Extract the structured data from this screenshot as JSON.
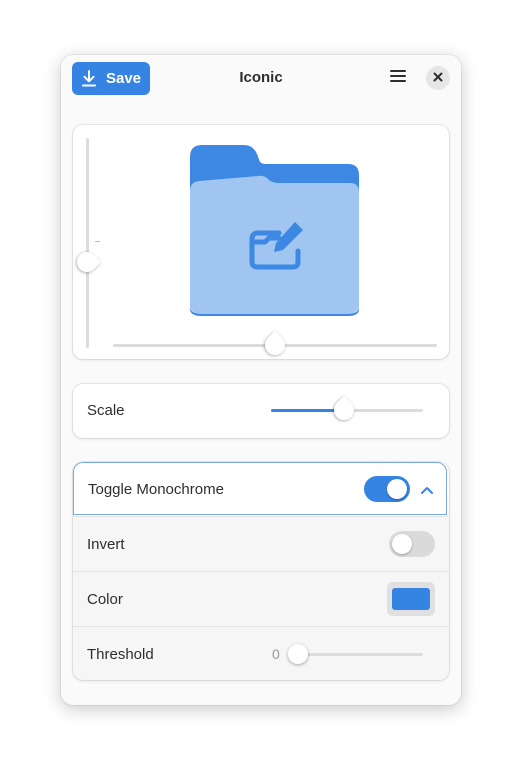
{
  "header": {
    "save_label": "Save",
    "title": "Iconic",
    "save_icon": "download-icon",
    "menu_icon": "hamburger-menu-icon",
    "close_icon": "close-icon"
  },
  "preview": {
    "icon": "folder-with-edit-icon",
    "vertical_slider_level": 0.5,
    "horizontal_slider_level": 0.5
  },
  "scale": {
    "label": "Scale",
    "level": 0.5
  },
  "monochrome": {
    "label": "Toggle Monochrome",
    "enabled": true,
    "expanded": true,
    "invert": {
      "label": "Invert",
      "enabled": false
    },
    "color": {
      "label": "Color",
      "value": "#3584e4"
    },
    "threshold": {
      "label": "Threshold",
      "value": "0",
      "level": 0
    }
  },
  "colors": {
    "accent": "#3584e4",
    "folder_back": "#3d88e2",
    "folder_front": "#9fc5f0",
    "switch_off": "#dadada"
  }
}
